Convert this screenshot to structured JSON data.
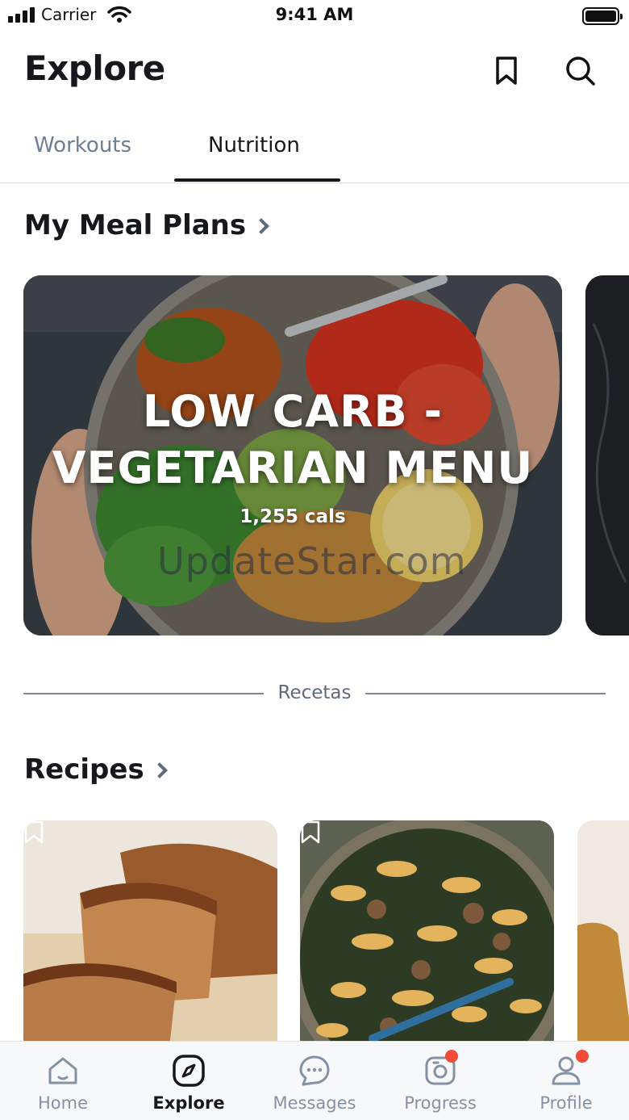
{
  "status_bar": {
    "carrier": "Carrier",
    "time": "9:41 AM"
  },
  "header": {
    "title": "Explore"
  },
  "icons": {
    "bookmark": "bookmark-icon",
    "search": "search-icon",
    "chevron": "chevron-right-icon"
  },
  "tabs": [
    {
      "label": "Workouts",
      "active": false
    },
    {
      "label": "Nutrition",
      "active": true
    }
  ],
  "meal_plans": {
    "title": "My Meal Plans",
    "cards": [
      {
        "title_line1": "LOW CARB -",
        "title_line2": "VEGETARIAN MENU",
        "cals": "1,255 cals"
      }
    ]
  },
  "watermark": "UpdateStar.com",
  "divider": {
    "label": "Recetas"
  },
  "recipes": {
    "title": "Recipes"
  },
  "tab_bar": {
    "items": [
      {
        "label": "Home",
        "icon": "home-icon",
        "active": false,
        "badge": false
      },
      {
        "label": "Explore",
        "icon": "compass-icon",
        "active": true,
        "badge": false
      },
      {
        "label": "Messages",
        "icon": "chat-icon",
        "active": false,
        "badge": false
      },
      {
        "label": "Progress",
        "icon": "camera-icon",
        "active": false,
        "badge": true
      },
      {
        "label": "Profile",
        "icon": "profile-icon",
        "active": false,
        "badge": true
      }
    ]
  },
  "colors": {
    "accent": "#16181c",
    "muted": "#6f7f92",
    "badge": "#f24b3b"
  }
}
